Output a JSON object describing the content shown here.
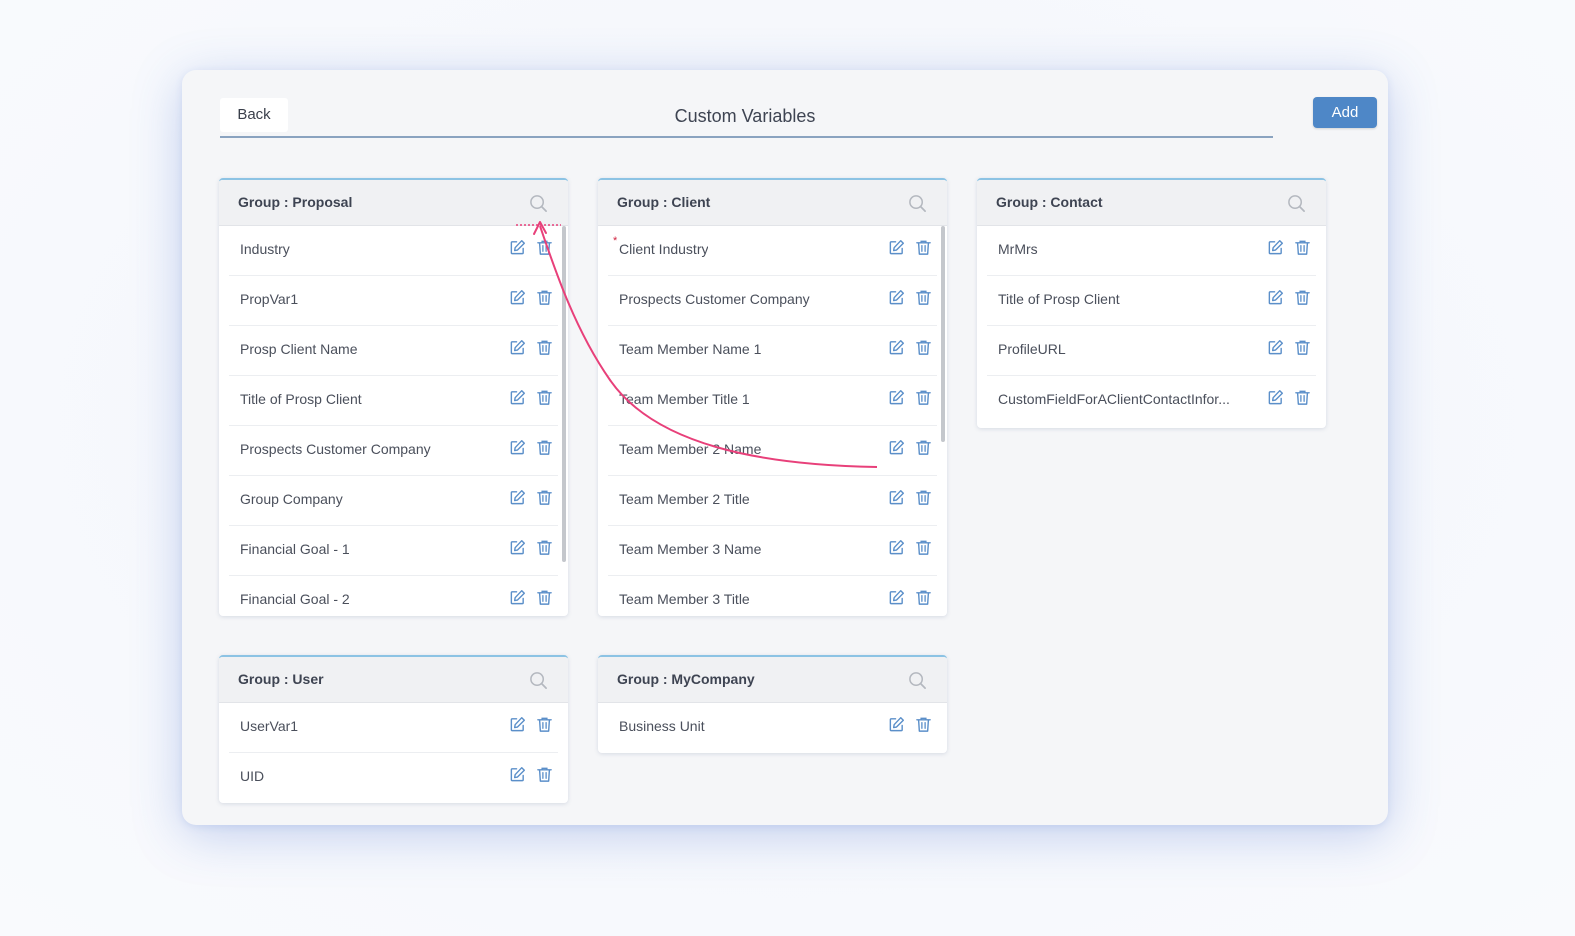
{
  "header": {
    "back_label": "Back",
    "title": "Custom Variables",
    "add_label": "Add"
  },
  "groups": {
    "proposal": {
      "title": "Group : Proposal",
      "items": [
        "Industry",
        "PropVar1",
        "Prosp Client Name",
        "Title of Prosp Client",
        "Prospects Customer Company",
        "Group Company",
        "Financial Goal - 1",
        "Financial Goal - 2"
      ]
    },
    "client": {
      "title": "Group : Client",
      "required_mark": "*",
      "items": [
        "Client Industry",
        "Prospects Customer Company",
        "Team Member Name 1",
        "Team Member Title 1",
        "Team Member 2 Name",
        "Team Member 2 Title",
        "Team Member 3 Name",
        "Team Member 3 Title"
      ]
    },
    "contact": {
      "title": "Group : Contact",
      "items": [
        "MrMrs",
        "Title of Prosp Client",
        "ProfileURL",
        "CustomFieldForAClientContactInfor..."
      ]
    },
    "user": {
      "title": "Group : User",
      "items": [
        "UserVar1",
        "UID"
      ]
    },
    "mycompany": {
      "title": "Group : MyCompany",
      "items": [
        "Business Unit"
      ]
    }
  },
  "colors": {
    "accent": "#4e87c7",
    "card_top_border": "#8cc3e4",
    "icon": "#5b8fc9",
    "annotation_arrow": "#e8407a"
  },
  "icons": [
    "search-icon",
    "edit-icon",
    "trash-icon"
  ]
}
